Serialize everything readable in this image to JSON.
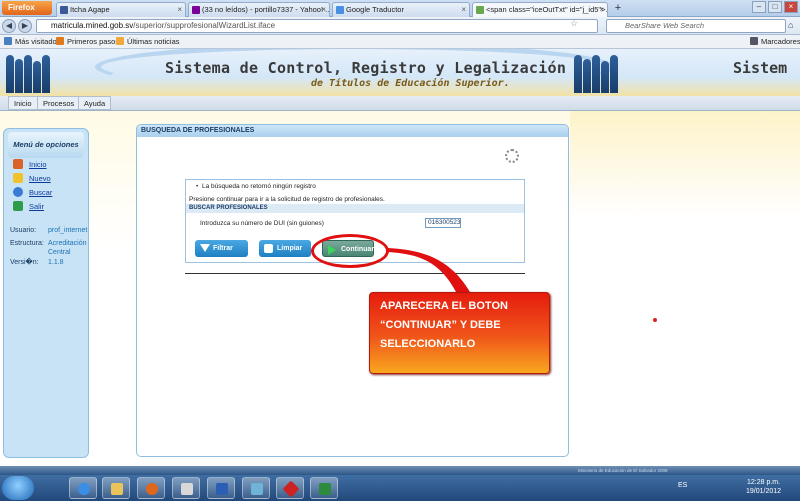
{
  "browser": {
    "app_button": "Firefox",
    "tabs": [
      {
        "label": "Itcha Agape",
        "color": "#3b5998"
      },
      {
        "label": "(33 no leídos) - portillo7337 - Yahoo! ...",
        "color": "#7b0099"
      },
      {
        "label": "Google Traductor",
        "color": "#4a90e2"
      },
      {
        "label": "<span class=\"iceOutTxt\" id=\"j_id5\">...",
        "color": "#6aa84f"
      }
    ],
    "url_host": "matricula.mined.gob.sv",
    "url_path": "/superior/supprofesionalWizardList.iface",
    "search_placeholder": "BearShare Web Search",
    "bookmarks": [
      "Más visitados",
      "Primeros pasos",
      "Últimas noticias"
    ],
    "bookmarks_menu": "Marcadores"
  },
  "site": {
    "title_line1": "Sistema de Control, Registro y Legalización",
    "title_line2": "de Títulos de Educación Superior.",
    "title_repeat": "Sistem",
    "menu": [
      "Inicio",
      "Procesos",
      "Ayuda"
    ]
  },
  "sidebar": {
    "header": "Menú de opciones",
    "items": [
      {
        "label": "Inicio",
        "icon": "home-icon"
      },
      {
        "label": "Nuevo",
        "icon": "star-icon"
      },
      {
        "label": "Buscar",
        "icon": "search-icon"
      },
      {
        "label": "Salir",
        "icon": "exit-icon"
      }
    ],
    "user_label": "Usuario:",
    "user_value": "prof_internet",
    "structure_label": "Estructura:",
    "structure_value": "Acreditación Central",
    "version_label": "Versi�n:",
    "version_value": "1.1.8"
  },
  "panel": {
    "header": "BUSQUEDA DE PROFESIONALES",
    "message": "La búsqueda no retornó ningún registro",
    "instructions": "Presione continuar para ir a la solicitud de registro de profesionales.",
    "section_title": "BUSCAR PROFESIONALES",
    "dui_label": "Introduzca su número de DUI (sin guiones)",
    "dui_value": "016300523",
    "btn_filter": "Filtrar",
    "btn_clear": "Limpiar",
    "btn_continue": "Continuar"
  },
  "callout": {
    "line1": "APARECERA EL BOTON",
    "line2": "“CONTINUAR” Y DEBE",
    "line3": "SELECCIONARLO"
  },
  "footer": "Ministerio de Educación de El Salvador 2008",
  "taskbar": {
    "language": "ES",
    "time": "12:28 p.m.",
    "date": "19/01/2012"
  }
}
